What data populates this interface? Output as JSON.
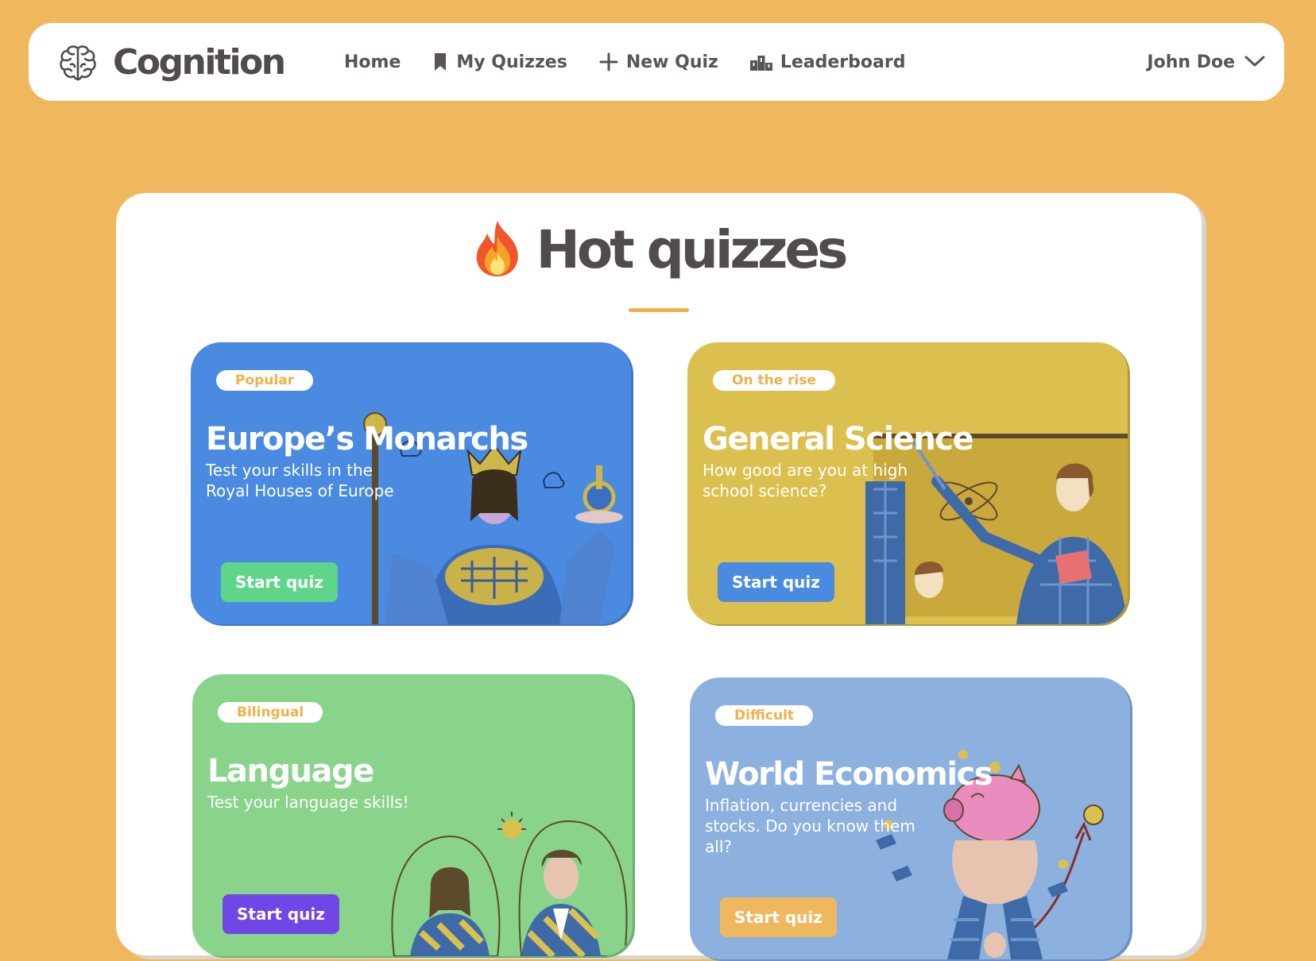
{
  "app": {
    "name": "Cognition"
  },
  "nav": {
    "items": [
      {
        "label": "Home",
        "icon": "none"
      },
      {
        "label": "My Quizzes",
        "icon": "bookmark-icon"
      },
      {
        "label": "New Quiz",
        "icon": "plus-icon"
      },
      {
        "label": "Leaderboard",
        "icon": "podium-icon"
      }
    ],
    "user": {
      "name": "John Doe",
      "icon": "chevron-down-icon"
    }
  },
  "section": {
    "title": "Hot quizzes",
    "icon": "fire-emoji"
  },
  "cards": [
    {
      "badge": "Popular",
      "title": "Europe’s Monarchs",
      "description": "Test your skills in the Royal Houses of Europe",
      "button": "Start quiz",
      "background": "#4A8BE1",
      "button_color": "#5FD58A",
      "illustration": "monarch-illustration"
    },
    {
      "badge": "On the rise",
      "title": "General Science",
      "description": "How good are you at high school science?",
      "button": "Start quiz",
      "background": "#DCC04F",
      "button_color": "#4A8BE1",
      "illustration": "scientist-illustration"
    },
    {
      "badge": "Bilingual",
      "title": "Language",
      "description": "Test your language skills!",
      "button": "Start quiz",
      "background": "#89D48A",
      "button_color": "#7046E6",
      "illustration": "conversation-illustration"
    },
    {
      "badge": "Difficult",
      "title": "World Economics",
      "description": "Inflation, currencies and stocks. Do you know them all?",
      "button": "Start quiz",
      "background": "#8CB1DE",
      "button_color": "#F0B85E",
      "illustration": "piggy-bank-illustration"
    }
  ],
  "colors": {
    "page_background": "#F0B85E",
    "accent": "#F0B04A",
    "text_dark": "#514B4B"
  }
}
